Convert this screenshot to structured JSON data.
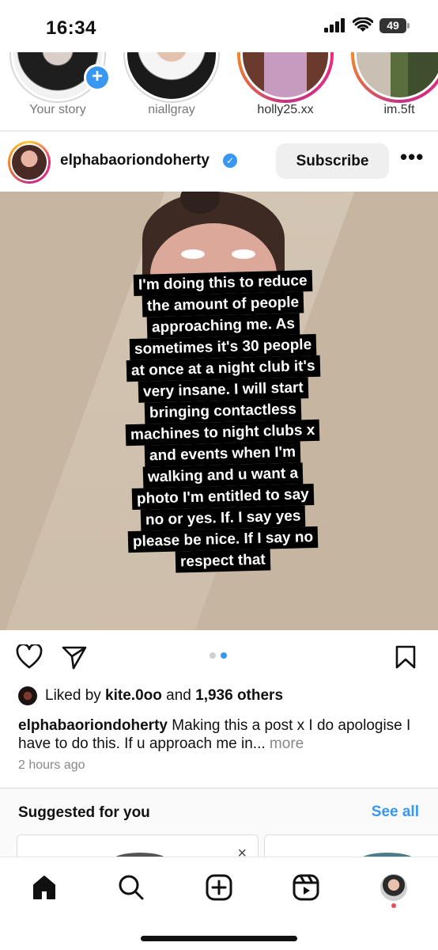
{
  "status_bar": {
    "time": "16:34",
    "battery": "49"
  },
  "stories": [
    {
      "label": "Your story",
      "seen": true,
      "has_add_badge": true,
      "photo_color": "#9a9a9a"
    },
    {
      "label": "niallgray",
      "seen": true,
      "photo_color": "#b9a89b"
    },
    {
      "label": "holly25.xx",
      "seen": false,
      "photo_color": "#8a5a6e"
    },
    {
      "label": "im.5ft",
      "seen": false,
      "photo_color": "#7c8a6a"
    }
  ],
  "post": {
    "username": "elphabaoriondoherty",
    "verified": true,
    "subscribe_label": "Subscribe",
    "more_label": "•••",
    "overlay_lines": [
      "I'm doing this to reduce",
      "the amount of people",
      "approaching me. As",
      "sometimes it's 30 people",
      "at once at a night club it's",
      "very insane. I will start",
      "bringing contactless",
      "machines to night clubs x",
      "and events when I'm",
      "walking and u want a",
      "photo I'm entitled to say",
      "no or yes. If. I say yes",
      "please be nice. If I say no",
      "respect that"
    ],
    "carousel": {
      "count": 2,
      "active_index": 1
    },
    "likes": {
      "prefix": "Liked by ",
      "user": "kite.0oo",
      "middle": " and ",
      "others": "1,936 others"
    },
    "caption": {
      "username": "elphabaoriondoherty",
      "text": " Making this a post x I do apologise I have to do this. If u approach me in...",
      "more": " more"
    },
    "timestamp": "2 hours ago"
  },
  "suggested": {
    "title": "Suggested for you",
    "see_all": "See all",
    "close_glyph": "×"
  },
  "tab_bar": {
    "icons": [
      "home-icon",
      "search-icon",
      "create-icon",
      "reels-icon",
      "profile-icon"
    ],
    "notification_dot_color": "#ed4956"
  },
  "colors": {
    "accent": "#3897f0",
    "text": "#111111",
    "muted": "#888888"
  }
}
